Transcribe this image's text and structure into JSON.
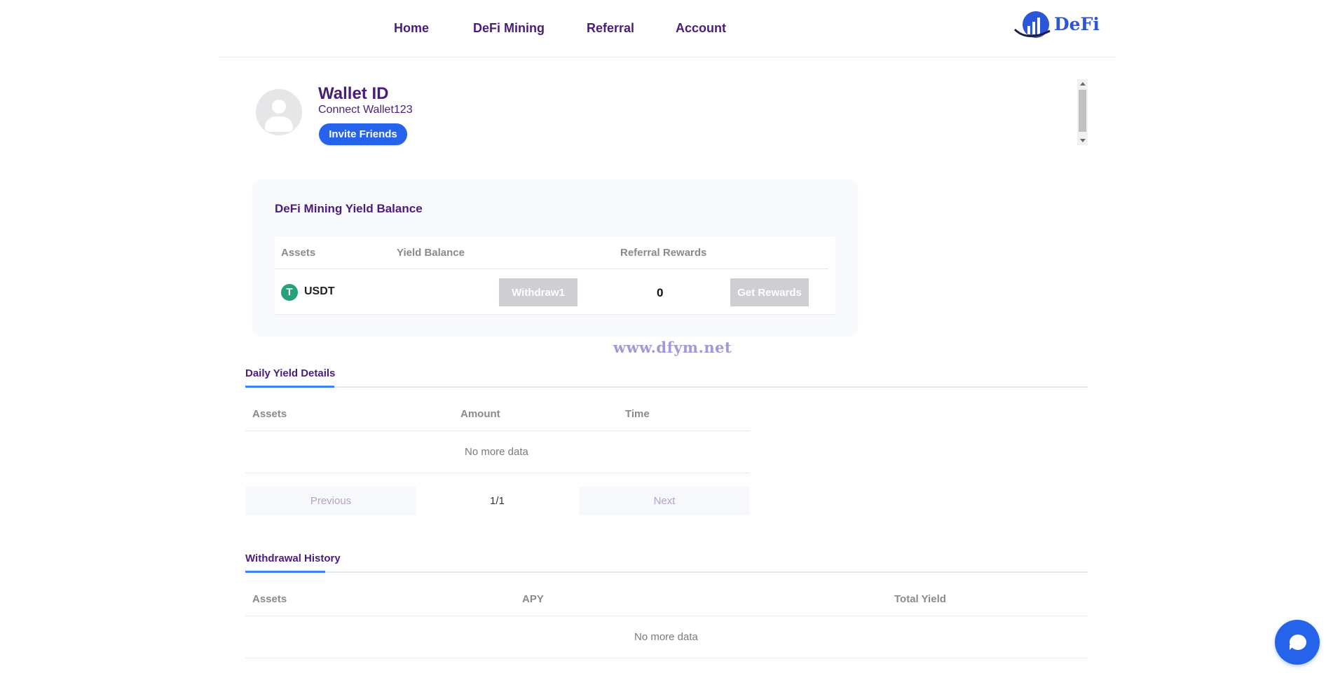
{
  "nav": {
    "items": [
      {
        "label": "Home"
      },
      {
        "label": "DeFi Mining"
      },
      {
        "label": "Referral"
      },
      {
        "label": "Account"
      }
    ],
    "logo_text": "DeFi"
  },
  "profile": {
    "title": "Wallet ID",
    "subtitle": "Connect Wallet123",
    "invite_label": "Invite Friends"
  },
  "yield_balance": {
    "title": "DeFi Mining Yield Balance",
    "columns": [
      "Assets",
      "Yield Balance",
      "Referral Rewards"
    ],
    "row": {
      "asset_icon": "T",
      "asset": "USDT",
      "withdraw_label": "Withdraw1",
      "referral_rewards": "0",
      "get_rewards_label": "Get Rewards"
    }
  },
  "watermark": "www.dfym.net",
  "daily_yield": {
    "tab_label": "Daily Yield Details",
    "columns": [
      "Assets",
      "Amount",
      "Time"
    ],
    "empty_text": "No more data",
    "pagination": {
      "previous_label": "Previous",
      "page": "1/1",
      "next_label": "Next"
    }
  },
  "withdrawal_history": {
    "tab_label": "Withdrawal History",
    "columns": [
      "Assets",
      "APY",
      "Total Yield"
    ],
    "empty_text": "No more data"
  },
  "colors": {
    "brand_purple": "#4b1d7a",
    "primary_blue": "#2563eb",
    "usdt_green": "#26a17b",
    "disabled_gray": "#cfcfd3"
  },
  "icons": {
    "avatar": "user-avatar-icon",
    "asset": "usdt-icon",
    "chat": "chat-bubble-icon"
  }
}
